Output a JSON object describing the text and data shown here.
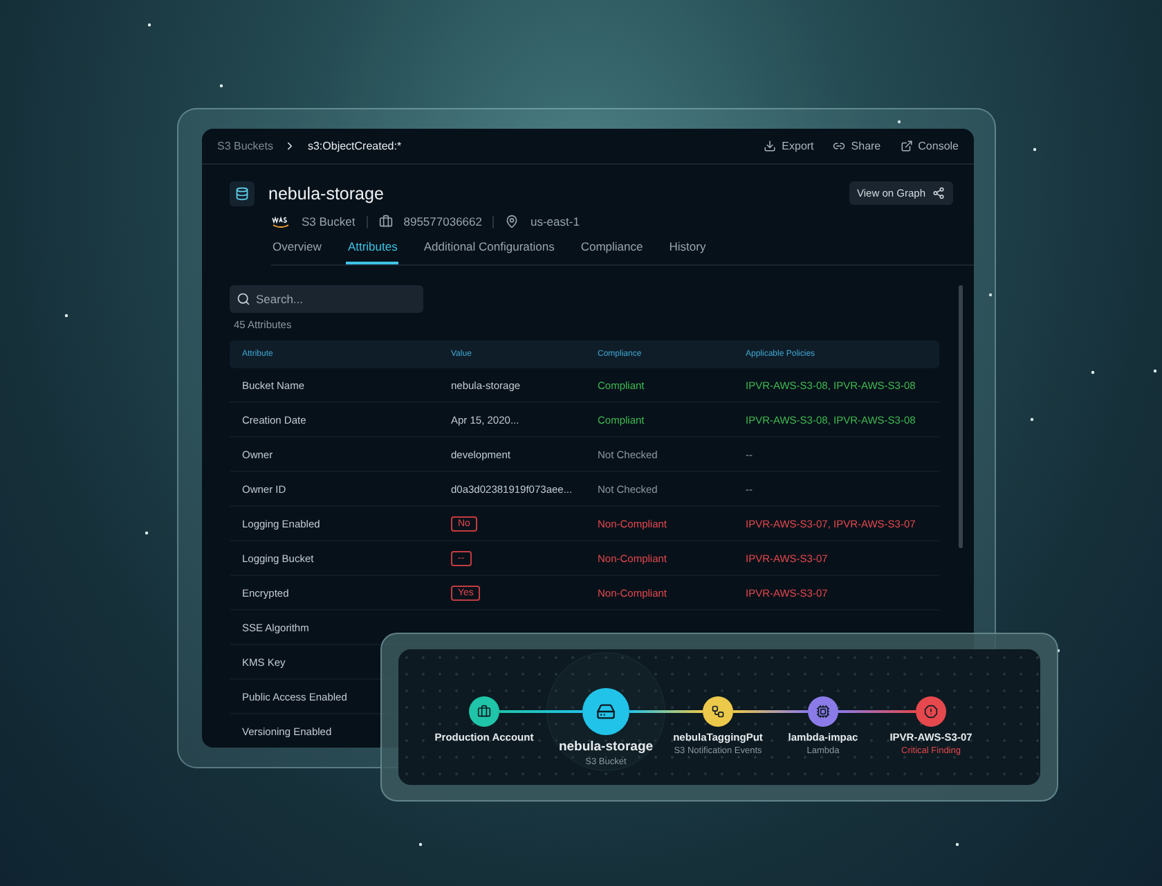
{
  "breadcrumbs": [
    {
      "label": "S3 Buckets",
      "current": false
    },
    {
      "label": "s3:ObjectCreated:*",
      "current": true
    }
  ],
  "header_actions": [
    {
      "label": "Export"
    },
    {
      "label": "Share"
    },
    {
      "label": "Console"
    }
  ],
  "resource": {
    "name": "nebula-storage",
    "type": "S3 Bucket",
    "account": "895577036662",
    "region": "us-east-1",
    "graph_button": "View on Graph"
  },
  "tabs": [
    {
      "label": "Overview",
      "selected": false
    },
    {
      "label": "Attributes",
      "selected": true
    },
    {
      "label": "Additional Configurations",
      "selected": false
    },
    {
      "label": "Compliance",
      "selected": false
    },
    {
      "label": "History",
      "selected": false
    }
  ],
  "search": {
    "placeholder": "Search..."
  },
  "attribute_count": "45 Attributes",
  "table": {
    "columns": [
      "Attribute",
      "Value",
      "Compliance",
      "Applicable Policies"
    ],
    "rows": [
      {
        "attribute": "Bucket Name",
        "value": "nebula-storage",
        "boxed": false,
        "compliance": "Compliant",
        "color": "#3fb950",
        "policies": "IPVR-AWS-S3-08, IPVR-AWS-S3-08"
      },
      {
        "attribute": "Creation Date",
        "value": "Apr 15, 2020...",
        "boxed": false,
        "compliance": "Compliant",
        "color": "#3fb950",
        "policies": "IPVR-AWS-S3-08, IPVR-AWS-S3-08"
      },
      {
        "attribute": "Owner",
        "value": "development",
        "boxed": false,
        "compliance": "Not Checked",
        "color": "#8d97a0",
        "policies": "--"
      },
      {
        "attribute": "Owner ID",
        "value": "d0a3d02381919f073aee...",
        "boxed": false,
        "compliance": "Not Checked",
        "color": "#8d97a0",
        "policies": "--"
      },
      {
        "attribute": "Logging Enabled",
        "value": "No",
        "boxed": true,
        "compliance": "Non-Compliant",
        "color": "#e5484d",
        "policies": "IPVR-AWS-S3-07, IPVR-AWS-S3-07"
      },
      {
        "attribute": "Logging Bucket",
        "value": "--",
        "boxed": true,
        "compliance": "Non-Compliant",
        "color": "#e5484d",
        "policies": "IPVR-AWS-S3-07"
      },
      {
        "attribute": "Encrypted",
        "value": "Yes",
        "boxed": true,
        "compliance": "Non-Compliant",
        "color": "#e5484d",
        "policies": "IPVR-AWS-S3-07"
      },
      {
        "attribute": "SSE Algorithm"
      },
      {
        "attribute": "KMS Key"
      },
      {
        "attribute": "Public Access Enabled"
      },
      {
        "attribute": "Versioning Enabled"
      }
    ]
  },
  "graph": {
    "nodes": [
      {
        "label": "Production Account",
        "color": "#20c4a8",
        "primary": false
      },
      {
        "label": "nebula-storage",
        "sublabel": "S3 Bucket",
        "color": "#22c3e8",
        "primary": true,
        "critical": false
      },
      {
        "label": "nebulaTaggingPut",
        "sublabel": "S3 Notification Events",
        "color": "#ecc94b",
        "primary": false,
        "critical": false
      },
      {
        "label": "lambda-impac",
        "sublabel": "Lambda",
        "color": "#8b7be8",
        "primary": false,
        "critical": false
      },
      {
        "label": "IPVR-AWS-S3-07",
        "sublabel": "Critical Finding",
        "color": "#e5484d",
        "primary": false,
        "critical": true
      }
    ]
  }
}
